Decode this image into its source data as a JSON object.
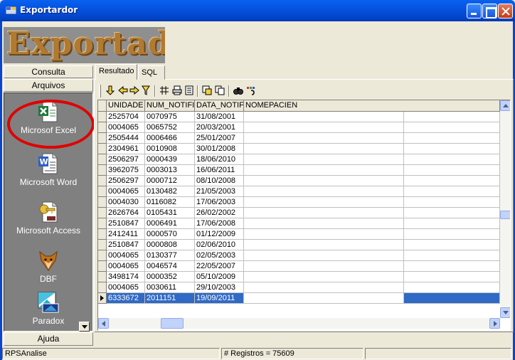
{
  "window": {
    "title": "Exportardor"
  },
  "logo": {
    "text": "Exportador"
  },
  "left_panel": {
    "consulta_label": "Consulta",
    "arquivos_label": "Arquivos",
    "ajuda_label": "Ajuda",
    "items": [
      {
        "label": "Microsof Excel",
        "icon": "excel-icon"
      },
      {
        "label": "Microsoft Word",
        "icon": "word-icon"
      },
      {
        "label": "Microsoft Access",
        "icon": "access-icon"
      },
      {
        "label": "DBF",
        "icon": "fox-icon"
      },
      {
        "label": "Paradox",
        "icon": "paradox-icon"
      }
    ]
  },
  "tabs": [
    {
      "label": "Resultado",
      "active": true
    },
    {
      "label": "SQL",
      "active": false
    }
  ],
  "toolbar": {
    "tools": [
      "first-record-icon",
      "prev-record-icon",
      "next-record-icon",
      "filter-icon",
      "grid-icon",
      "print-icon",
      "print-preview-icon",
      "export-icon",
      "copy-icon",
      "find-icon",
      "color-icon"
    ]
  },
  "grid": {
    "columns": [
      "UNIDADE",
      "NUM_NOTIFI",
      "DATA_NOTIF",
      "NOMEPACIEN"
    ],
    "rows": [
      [
        "2525704",
        "0070975",
        "31/08/2001"
      ],
      [
        "0004065",
        "0065752",
        "20/03/2001"
      ],
      [
        "2505444",
        "0006466",
        "25/01/2007"
      ],
      [
        "2304961",
        "0010908",
        "30/01/2008"
      ],
      [
        "2506297",
        "0000439",
        "18/06/2010"
      ],
      [
        "3962075",
        "0003013",
        "16/06/2011"
      ],
      [
        "2506297",
        "0000712",
        "08/10/2008"
      ],
      [
        "0004065",
        "0130482",
        "21/05/2003"
      ],
      [
        "0004030",
        "0116082",
        "17/06/2003"
      ],
      [
        "2626764",
        "0105431",
        "26/02/2002"
      ],
      [
        "2510847",
        "0006491",
        "17/06/2008"
      ],
      [
        "2412411",
        "0000570",
        "01/12/2009"
      ],
      [
        "2510847",
        "0000808",
        "02/06/2010"
      ],
      [
        "0004065",
        "0130377",
        "02/05/2003"
      ],
      [
        "0004065",
        "0046574",
        "22/05/2007"
      ],
      [
        "3498174",
        "0000352",
        "05/10/2009"
      ],
      [
        "0004065",
        "0030611",
        "29/10/2003"
      ],
      [
        "6333672",
        "2011151",
        "19/09/2011"
      ]
    ],
    "selected_row": 17
  },
  "status": {
    "left": "RPSAnalise",
    "records": "# Registros = 75609"
  },
  "colors": {
    "titlebar": "#0553e1",
    "selection": "#316ac5",
    "highlight_ellipse": "#e00000"
  }
}
